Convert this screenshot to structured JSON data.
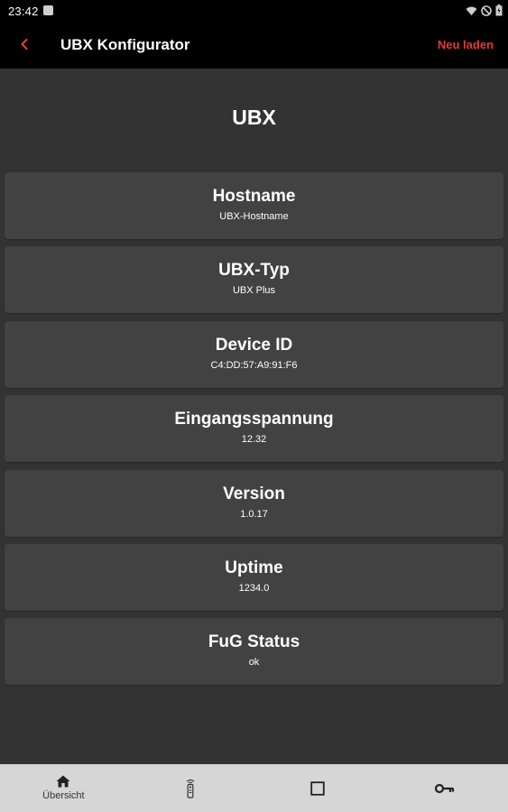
{
  "status_bar": {
    "time": "23:42",
    "icons": [
      "notification-icon",
      "wifi-icon",
      "do-not-disturb-icon",
      "battery-icon"
    ]
  },
  "app_bar": {
    "back_icon": "chevron-left-icon",
    "title": "UBX Konfigurator",
    "reload_label": "Neu laden",
    "accent_color": "#e53935"
  },
  "device": {
    "title": "UBX"
  },
  "info": [
    {
      "label": "Hostname",
      "value": "UBX-Hostname"
    },
    {
      "label": "UBX-Typ",
      "value": "UBX Plus"
    },
    {
      "label": "Device ID",
      "value": "C4:DD:57:A9:91:F6"
    },
    {
      "label": "Eingangsspannung",
      "value": "12.32"
    },
    {
      "label": "Version",
      "value": "1.0.17"
    },
    {
      "label": "Uptime",
      "value": "1234.0"
    },
    {
      "label": "FuG Status",
      "value": "ok"
    }
  ],
  "bottom_nav": {
    "items": [
      {
        "icon": "home-icon",
        "label": "Übersicht",
        "active": true
      },
      {
        "icon": "remote-icon",
        "label": ""
      },
      {
        "icon": "square-icon",
        "label": ""
      },
      {
        "icon": "key-icon",
        "label": ""
      }
    ]
  }
}
